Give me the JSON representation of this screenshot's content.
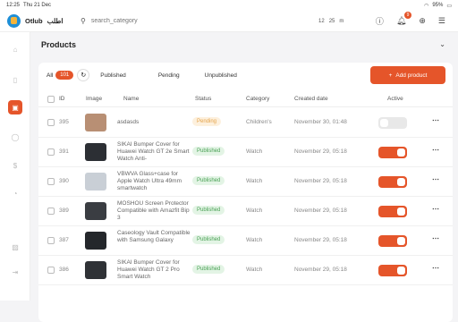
{
  "statusbar": {
    "time": "12:25",
    "date": "Thu 21 Dec",
    "battery": "95%"
  },
  "topbar": {
    "brand": "Otlub",
    "brand_ar": "اطلب",
    "search_placeholder": "search_category",
    "clock": {
      "h": "12",
      "m": "25",
      "ampm": "m"
    },
    "notification_count": "9"
  },
  "page": {
    "title": "Products"
  },
  "tabs": {
    "all_label": "All",
    "all_count": "101",
    "items": [
      "Published",
      "Pending",
      "Unpublished"
    ]
  },
  "add_button": {
    "label": "Add product"
  },
  "table": {
    "headers": {
      "id": "ID",
      "image": "Image",
      "name": "Name",
      "status": "Status",
      "category": "Category",
      "created": "Created date",
      "active": "Active"
    },
    "rows": [
      {
        "id": "395",
        "name": "asdasds",
        "status": "Pending",
        "category": "Children's",
        "created": "November 30, 01:48",
        "active": false,
        "thumb_color": "#b88f74"
      },
      {
        "id": "391",
        "name": "SIKAI Bumper Cover for Huawei Watch GT 2e Smart Watch Anti-",
        "status": "Published",
        "category": "Watch",
        "created": "November 29, 05:18",
        "active": true,
        "thumb_color": "#2c2f34"
      },
      {
        "id": "390",
        "name": "VBWVA Glass+case for Apple Watch Ultra 49mm smartwatch",
        "status": "Published",
        "category": "Watch",
        "created": "November 29, 05:18",
        "active": true,
        "thumb_color": "#c9cfd6"
      },
      {
        "id": "389",
        "name": "MOSHOU Screen Protector Compatible with Amazfit Bip 3",
        "status": "Published",
        "category": "Watch",
        "created": "November 29, 05:18",
        "active": true,
        "thumb_color": "#3a3d42"
      },
      {
        "id": "387",
        "name": "Caseology Vault Compatible with Samsung Galaxy",
        "status": "Published",
        "category": "Watch",
        "created": "November 29, 05:18",
        "active": true,
        "thumb_color": "#24272b"
      },
      {
        "id": "386",
        "name": "SIKAI Bumper Cover for Huawei Watch GT 2 Pro Smart Watch",
        "status": "Published",
        "category": "Watch",
        "created": "November 29, 05:18",
        "active": true,
        "thumb_color": "#2f3236"
      }
    ]
  },
  "colors": {
    "accent": "#e5552a",
    "published_bg": "#e3f4e5",
    "pending_bg": "#fdf0dd"
  }
}
